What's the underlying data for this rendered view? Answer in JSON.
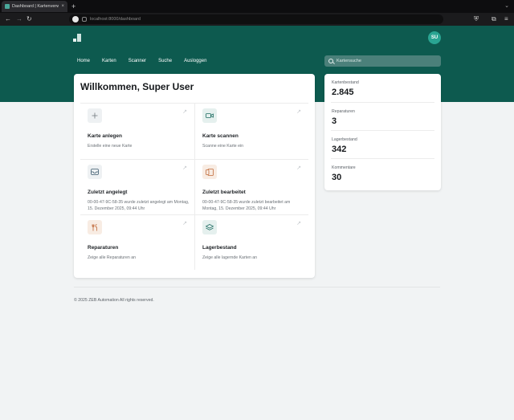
{
  "browser": {
    "tab_title": "Dashboard | Kartenverwaltung",
    "url_text": "localhost:8000/dashboard",
    "tab_close": "×",
    "new_tab": "+",
    "tab_list": "⌄",
    "back": "←",
    "forward": "→",
    "reload": "↻",
    "menu": "≡",
    "shield": "⛨",
    "extensions": "⧉"
  },
  "header": {
    "avatar_initials": "SU",
    "nav": [
      "Home",
      "Karten",
      "Scanner",
      "Suche",
      "Ausloggen"
    ],
    "search_placeholder": "Kartensuche"
  },
  "main": {
    "welcome": "Willkommen, Super User",
    "cards": [
      {
        "title": "Karte anlegen",
        "desc": "Erstelle eine neue Karte",
        "icon": "plus-icon"
      },
      {
        "title": "Karte scannen",
        "desc": "Scanne eine Karte ein",
        "icon": "video-camera-icon"
      },
      {
        "title": "Zuletzt angelegt",
        "desc": "00-00-47-9C-58-35 wurde zuletzt angelegt am Montag, 15. Dezember 2025, 09:44 Uhr",
        "icon": "inbox-icon"
      },
      {
        "title": "Zuletzt bearbeitet",
        "desc": "00-00-47-9C-58-35 wurde zuletzt bearbeitet am Montag, 15. Dezember 2025, 09:44 Uhr",
        "icon": "cards-icon"
      },
      {
        "title": "Reparaturen",
        "desc": "Zeige alle Reparaturen an",
        "icon": "wrench-icon"
      },
      {
        "title": "Lagerbestand",
        "desc": "Zeige alle lagernde Karten an",
        "icon": "layers-icon"
      }
    ],
    "arrow": "↗"
  },
  "stats": [
    {
      "label": "Kartenbestand",
      "value": "2.845"
    },
    {
      "label": "Reparaturen",
      "value": "3"
    },
    {
      "label": "Lagerbestand",
      "value": "342"
    },
    {
      "label": "Kommentare",
      "value": "30"
    }
  ],
  "footer": {
    "copyright": "© 2025 ZEB Automation All rights reserved."
  },
  "colors": {
    "brand": "#0d5a4f",
    "avatar": "#2aa492"
  }
}
